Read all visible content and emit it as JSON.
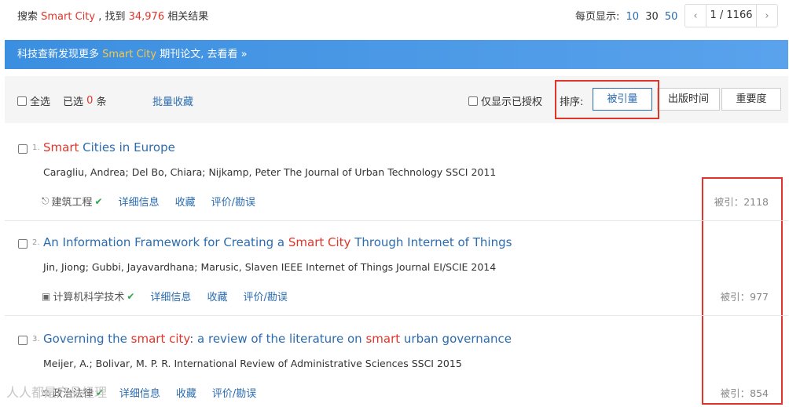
{
  "summary": {
    "prefix": "搜索 ",
    "query": "Smart City",
    "middle": " , 找到 ",
    "count": "34,976",
    "suffix": " 相关结果"
  },
  "per_page": {
    "label": "每页显示:",
    "options": [
      "10",
      "30",
      "50"
    ],
    "selected": "30"
  },
  "pager": {
    "page_text": "1 / 1166",
    "prev_icon": "chevron-left-icon",
    "next_icon": "chevron-right-icon"
  },
  "banner": {
    "text_before": "科技查新发现更多 ",
    "highlight": "Smart City",
    "text_after": " 期刊论文, 去看看 ",
    "arrow": "»"
  },
  "toolbar": {
    "select_all": "全选",
    "selected_label": "已选",
    "selected_count": "0",
    "selected_unit": "条",
    "batch_collect": "批量收藏",
    "only_authorized": "仅显示已授权",
    "sort_label": "排序:",
    "sort_options": [
      "被引量",
      "出版时间",
      "重要度"
    ],
    "active_sort": "被引量"
  },
  "results": [
    {
      "index": "1.",
      "title_parts": [
        {
          "text": "Smart",
          "hit": true
        },
        {
          "text": " Cities in Europe",
          "hit": false
        }
      ],
      "meta": "Caragliu, Andrea; Del Bo, Chiara; Nijkamp, Peter The Journal of Urban Technology SSCI 2011",
      "category": "建筑工程",
      "category_icon": "building-icon",
      "actions": [
        "详细信息",
        "收藏",
        "评价/勘误"
      ],
      "cited": "被引：2118"
    },
    {
      "index": "2.",
      "title_parts": [
        {
          "text": "An Information Framework for Creating a ",
          "hit": false
        },
        {
          "text": "Smart City",
          "hit": true
        },
        {
          "text": " Through Internet of Things",
          "hit": false
        }
      ],
      "meta": "Jin, Jiong; Gubbi, Jayavardhana; Marusic, Slaven IEEE Internet of Things Journal EI/SCIE 2014",
      "category": "计算机科学技术",
      "category_icon": "monitor-icon",
      "actions": [
        "详细信息",
        "收藏",
        "评价/勘误"
      ],
      "cited": "被引：977"
    },
    {
      "index": "3.",
      "title_parts": [
        {
          "text": "Governing the ",
          "hit": false
        },
        {
          "text": "smart city",
          "hit": true
        },
        {
          "text": ": a review of the literature on ",
          "hit": false
        },
        {
          "text": "smart",
          "hit": true
        },
        {
          "text": " urban governance",
          "hit": false
        }
      ],
      "meta": "Meijer, A.; Bolivar, M. P. R. International Review of Administrative Sciences SSCI 2015",
      "category": "政治法律",
      "category_icon": "scale-icon",
      "actions": [
        "详细信息",
        "收藏",
        "评价/勘误"
      ],
      "cited": "被引：854"
    }
  ],
  "watermark": "人人都是产品经理",
  "colors": {
    "link": "#2b6cb0",
    "highlight_red": "#e0352b",
    "banner_bg": "#3b8fe0",
    "banner_highlight": "#f7c948",
    "annotation_box": "#e0352b",
    "check_green": "#2aa34a"
  }
}
